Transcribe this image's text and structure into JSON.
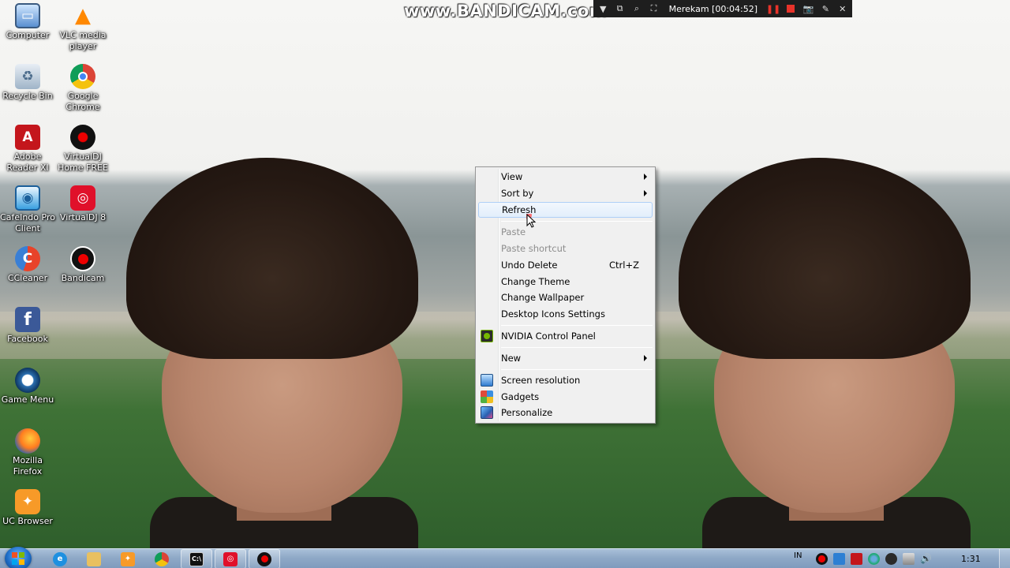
{
  "desktop": {
    "icons": [
      {
        "label": "Computer",
        "icon": "computer-icon"
      },
      {
        "label": "VLC media player",
        "icon": "vlc-icon"
      },
      {
        "label": "Recycle Bin",
        "icon": "recycle-bin-icon"
      },
      {
        "label": "Google Chrome",
        "icon": "chrome-icon"
      },
      {
        "label": "Adobe Reader XI",
        "icon": "adobe-reader-icon"
      },
      {
        "label": "VirtualDJ Home FREE",
        "icon": "virtualdj-icon"
      },
      {
        "label": "CafeIndo Pro Client",
        "icon": "cafeindo-icon"
      },
      {
        "label": "VirtualDJ 8",
        "icon": "virtualdj8-icon"
      },
      {
        "label": "CCleaner",
        "icon": "ccleaner-icon"
      },
      {
        "label": "Bandicam",
        "icon": "bandicam-icon"
      },
      {
        "label": "Facebook",
        "icon": "facebook-icon"
      },
      {
        "label": "Game Menu",
        "icon": "game-menu-icon"
      },
      {
        "label": "Mozilla Firefox",
        "icon": "firefox-icon"
      },
      {
        "label": "UC Browser",
        "icon": "uc-browser-icon"
      }
    ]
  },
  "bandicam": {
    "watermark": "www.BANDICAM.com",
    "status": "Merekam [00:04:52]"
  },
  "context_menu": {
    "items": {
      "view": "View",
      "sort_by": "Sort by",
      "refresh": "Refresh",
      "paste": "Paste",
      "paste_shortcut": "Paste shortcut",
      "undo_delete": "Undo Delete",
      "undo_delete_shortcut": "Ctrl+Z",
      "change_theme": "Change Theme",
      "change_wallpaper": "Change Wallpaper",
      "desktop_icons_settings": "Desktop Icons Settings",
      "nvidia_control_panel": "NVIDIA Control Panel",
      "new": "New",
      "screen_resolution": "Screen resolution",
      "gadgets": "Gadgets",
      "personalize": "Personalize"
    }
  },
  "taskbar": {
    "language": "IN",
    "clock": "1:31"
  },
  "colors": {
    "bandicam_bar": "#1e1e1e",
    "menu_background": "#f0f0f0",
    "menu_hover_border": "#aecff7",
    "taskbar": "#8fa9c7"
  }
}
